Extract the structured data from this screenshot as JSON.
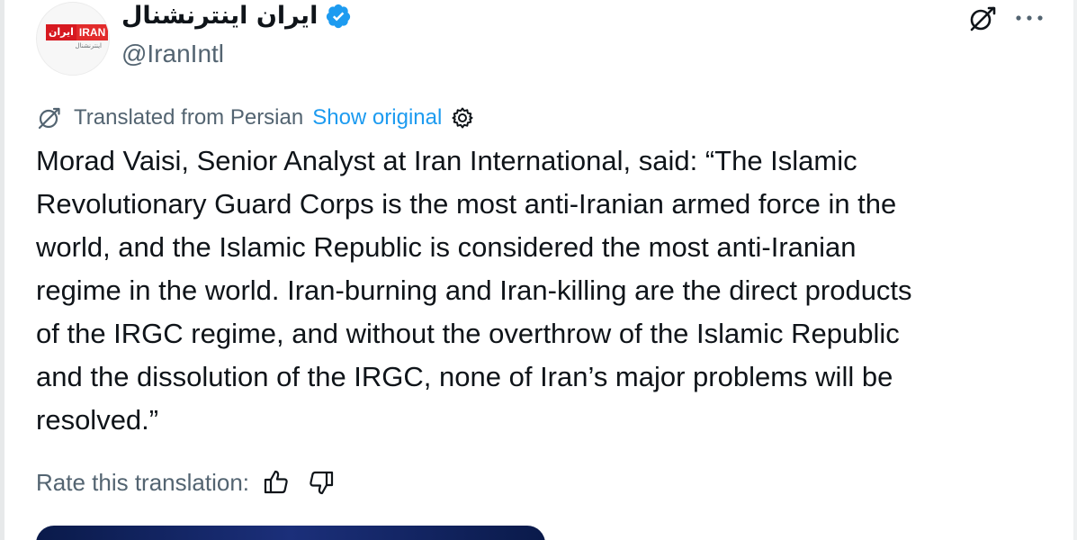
{
  "account": {
    "display_name": "ایران اینترنشنال",
    "handle": "@IranIntl",
    "verified": true,
    "avatar_logo": {
      "top_fa": "ایران",
      "top_en": "IRAN",
      "bottom_fa": "اینترنشنال"
    }
  },
  "header_icons": [
    "translate-icon",
    "more-icon"
  ],
  "translation": {
    "label": "Translated from Persian",
    "show_original": "Show original"
  },
  "post": {
    "lines": [
      "Morad Vaisi, Senior Analyst at Iran International, said: “The Islamic",
      "Revolutionary Guard Corps is the most anti-Iranian armed force in the",
      "world, and the Islamic Republic is considered the most anti-Iranian",
      "regime in the world. Iran-burning and Iran-killing are the direct products",
      "of the IRGC regime, and without the overthrow of the Islamic Republic",
      "and the dissolution of the IRGC, none of Iran’s major problems will be",
      "resolved.”"
    ]
  },
  "rating": {
    "label": "Rate this translation:"
  },
  "colors": {
    "text": "#0f1419",
    "secondary": "#536471",
    "link": "#1d9bf0",
    "verified": "#1d9bf0",
    "logo_red": "#d71920",
    "media_dark": "#0a1a4a"
  }
}
